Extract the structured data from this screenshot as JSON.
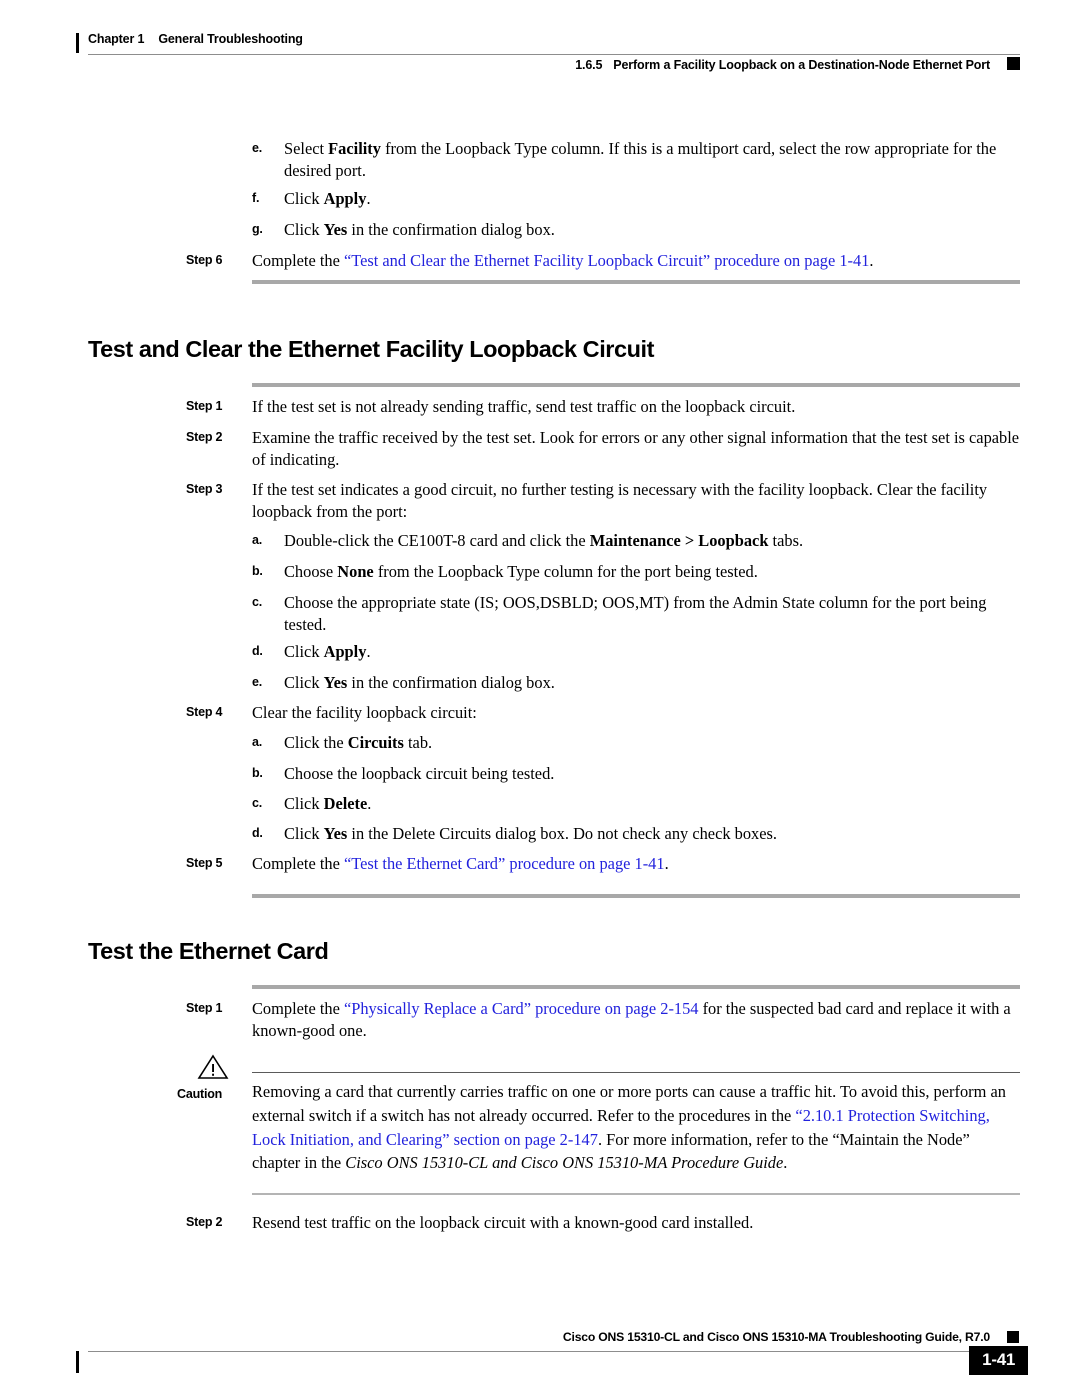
{
  "header": {
    "chapter": "Chapter 1",
    "chapter_title": "General Troubleshooting",
    "section_number": "1.6.5",
    "section_title": "Perform a Facility Loopback on a Destination-Node Ethernet Port"
  },
  "top_steps": {
    "e_label": "e.",
    "e_text_1": "Select ",
    "e_bold_1": "Facility",
    "e_text_2": " from the Loopback Type column. If this is a multiport card, select the row appropriate for the desired port.",
    "f_label": "f.",
    "f_text_1": "Click ",
    "f_bold_1": "Apply",
    "f_text_2": ".",
    "g_label": "g.",
    "g_text_1": "Click ",
    "g_bold_1": "Yes",
    "g_text_2": " in the confirmation dialog box.",
    "step6_label": "Step 6",
    "step6_text_1": "Complete the ",
    "step6_link": "“Test and Clear the Ethernet Facility Loopback Circuit” procedure on page 1-41",
    "step6_text_2": "."
  },
  "section_a": {
    "heading": "Test and Clear the Ethernet Facility Loopback Circuit",
    "step1_label": "Step 1",
    "step1_text": "If the test set is not already sending traffic, send test traffic on the loopback circuit.",
    "step2_label": "Step 2",
    "step2_text": "Examine the traffic received by the test set. Look for errors or any other signal information that the test set is capable of indicating.",
    "step3_label": "Step 3",
    "step3_text": "If the test set indicates a good circuit, no further testing is necessary with the facility loopback. Clear the facility loopback from the port:",
    "step3a_label": "a.",
    "step3a_text_1": "Double-click the CE100T-8 card and click the ",
    "step3a_bold": "Maintenance > Loopback",
    "step3a_text_2": " tabs.",
    "step3b_label": "b.",
    "step3b_text_1": "Choose ",
    "step3b_bold": "None",
    "step3b_text_2": " from the Loopback Type column for the port being tested.",
    "step3c_label": "c.",
    "step3c_text": "Choose the appropriate state (IS; OOS,DSBLD; OOS,MT) from the Admin State column for the port being tested.",
    "step3d_label": "d.",
    "step3d_text_1": "Click ",
    "step3d_bold": "Apply",
    "step3d_text_2": ".",
    "step3e_label": "e.",
    "step3e_text_1": "Click ",
    "step3e_bold": "Yes",
    "step3e_text_2": " in the confirmation dialog box.",
    "step4_label": "Step 4",
    "step4_text": "Clear the facility loopback circuit:",
    "step4a_label": "a.",
    "step4a_text_1": "Click the ",
    "step4a_bold": "Circuits",
    "step4a_text_2": " tab.",
    "step4b_label": "b.",
    "step4b_text": "Choose the loopback circuit being tested.",
    "step4c_label": "c.",
    "step4c_text_1": "Click ",
    "step4c_bold": "Delete",
    "step4c_text_2": ".",
    "step4d_label": "d.",
    "step4d_text_1": "Click ",
    "step4d_bold": "Yes",
    "step4d_text_2": " in the Delete Circuits dialog box. Do not check any check boxes.",
    "step5_label": "Step 5",
    "step5_text_1": "Complete the ",
    "step5_link": "“Test the Ethernet Card” procedure on page 1-41",
    "step5_text_2": "."
  },
  "section_b": {
    "heading": "Test the Ethernet Card",
    "step1_label": "Step 1",
    "step1_text_1": "Complete the ",
    "step1_link": "“Physically Replace a Card” procedure on page 2-154",
    "step1_text_2": " for the suspected bad card and replace it with a known-good one.",
    "caution_label": "Caution",
    "caution_icon": "warning-triangle-icon",
    "caution_text_1": "Removing a card that currently carries traffic on one or more ports can cause a traffic hit. To avoid this, perform an external switch if a switch has not already occurred. Refer to the procedures in the ",
    "caution_link": "“2.10.1  Protection Switching, Lock Initiation, and Clearing” section on page 2-147",
    "caution_text_2": ". For more information, refer to the “Maintain the Node” chapter in the ",
    "caution_italic": "Cisco ONS 15310-CL and Cisco ONS 15310-MA Procedure Guide",
    "caution_text_3": ".",
    "step2_label": "Step 2",
    "step2_text": "Resend test traffic on the loopback circuit with a known-good card installed."
  },
  "footer": {
    "guide_title": "Cisco ONS 15310-CL and Cisco ONS 15310-MA Troubleshooting Guide, R7.0",
    "page_number": "1-41"
  },
  "colors": {
    "link": "#2222dd",
    "rule_thick": "#a8a8a8",
    "rule_thin": "#8d8d8d",
    "text": "#000000"
  }
}
